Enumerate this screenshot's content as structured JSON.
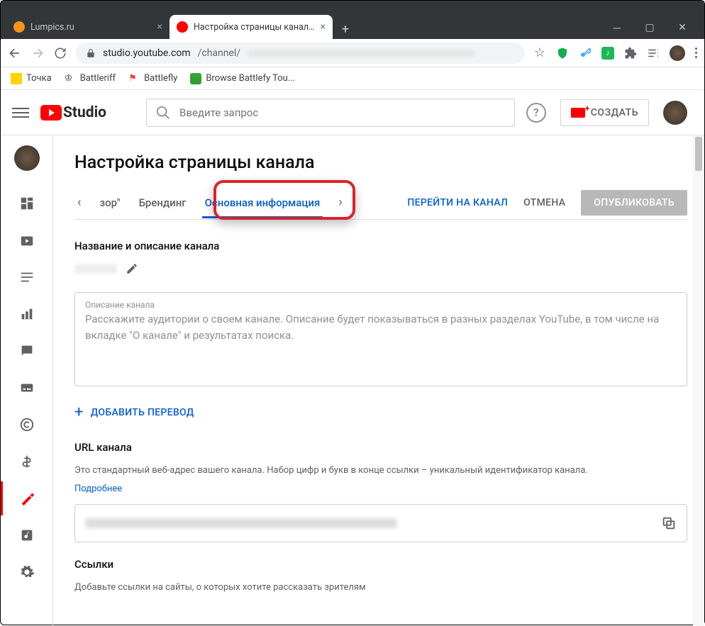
{
  "browser": {
    "tabs": [
      {
        "label": "Lumpics.ru"
      },
      {
        "label": "Настройка страницы канала - Y"
      }
    ],
    "url_prefix": "studio.youtube.com",
    "url_path": "/channel/",
    "bookmarks": [
      {
        "label": "Точка"
      },
      {
        "label": "Battleriff"
      },
      {
        "label": "Battlefly"
      },
      {
        "label": "Browse Battlefy Tou..."
      }
    ]
  },
  "header": {
    "logo_text": "Studio",
    "search_placeholder": "Введите запрос",
    "create_label": "СОЗДАТЬ"
  },
  "page": {
    "title": "Настройка страницы канала",
    "tab_truncated": "зор\"",
    "tab_branding": "Брендинг",
    "tab_basic": "Основная информация",
    "go_channel": "ПЕРЕЙТИ НА КАНАЛ",
    "cancel": "ОТМЕНА",
    "publish": "ОПУБЛИКОВАТЬ"
  },
  "sections": {
    "name_title": "Название и описание канала",
    "desc_label": "Описание канала",
    "desc_placeholder": "Расскажите аудитории о своем канале. Описание будет показываться в разных разделах YouTube, в том числе на вкладке \"О канале\" и результатах поиска.",
    "add_translate": "ДОБАВИТЬ ПЕРЕВОД",
    "url_title": "URL канала",
    "url_desc": "Это стандартный веб-адрес вашего канала. Набор цифр и букв в конце ссылки – уникальный идентификатор канала.",
    "learn_more": "Подробнее",
    "links_title": "Ссылки",
    "links_desc": "Добавьте ссылки на сайты, о которых хотите рассказать зрителям"
  }
}
